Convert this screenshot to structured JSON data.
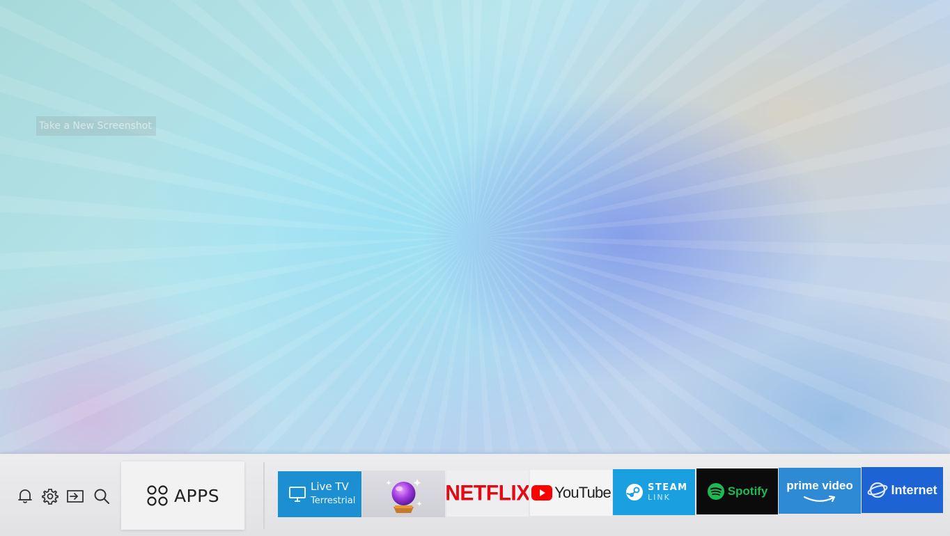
{
  "background": {
    "description_colors": [
      "#a7d9da",
      "#b9e6ee",
      "#b6d2ef",
      "#d6d8e2"
    ]
  },
  "tooltip": {
    "text": "Take a New Screenshot"
  },
  "system_icons": [
    {
      "name": "notifications",
      "icon": "bell-icon"
    },
    {
      "name": "settings",
      "icon": "gear-icon"
    },
    {
      "name": "source",
      "icon": "source-input-icon"
    },
    {
      "name": "search",
      "icon": "search-icon"
    }
  ],
  "apps_tile": {
    "label": "APPS",
    "icon": "apps-grid-icon"
  },
  "tiles": {
    "live_tv": {
      "title": "Live TV",
      "subtitle": "Terrestrial",
      "icon": "tv-icon",
      "color": "#1b8fd1"
    },
    "crystal_ball": {
      "icon": "crystal-ball-icon",
      "color": "#dedde4"
    },
    "netflix": {
      "logo_text": "NETFLIX",
      "color": "#e50914"
    },
    "youtube": {
      "logo_text": "YouTube",
      "color": "#ff0000"
    },
    "steam_link": {
      "line1": "STEAM",
      "line2": "LINK",
      "color": "#1a9fe0"
    },
    "spotify": {
      "logo_text": "Spotify",
      "color": "#1db954"
    },
    "prime_video": {
      "logo_text": "prime video",
      "color": "#2f8ad6"
    },
    "internet": {
      "logo_text": "Internet",
      "color": "#1e63d4"
    }
  }
}
